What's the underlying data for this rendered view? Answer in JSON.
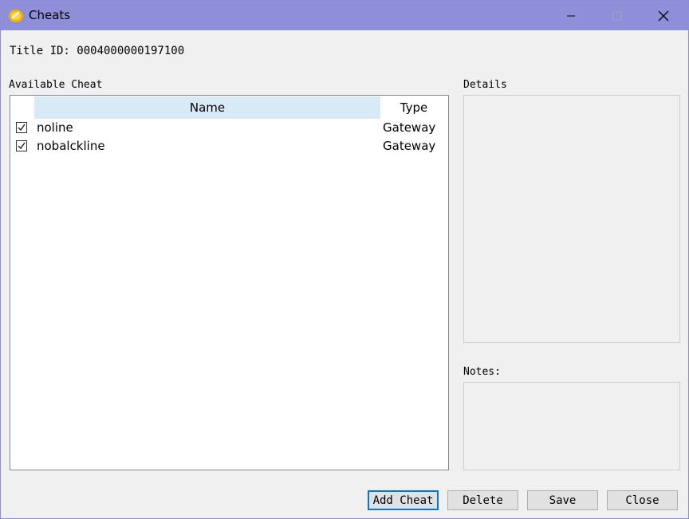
{
  "window": {
    "title": "Cheats"
  },
  "title_id": "Title ID: 0004000000197100",
  "available_label": "Available Cheat",
  "columns": {
    "name": "Name",
    "type": "Type"
  },
  "cheats": [
    {
      "name": "noline",
      "type": "Gateway",
      "checked": true
    },
    {
      "name": "nobalckline",
      "type": "Gateway",
      "checked": true
    }
  ],
  "details_label": "Details",
  "notes_label": "Notes:",
  "buttons": {
    "add": "Add Cheat",
    "delete": "Delete",
    "save": "Save",
    "close": "Close"
  },
  "colors": {
    "titlebar": "#8f8ed9",
    "header_highlight": "#d9eaf7",
    "default_button_border": "#0078d7"
  }
}
